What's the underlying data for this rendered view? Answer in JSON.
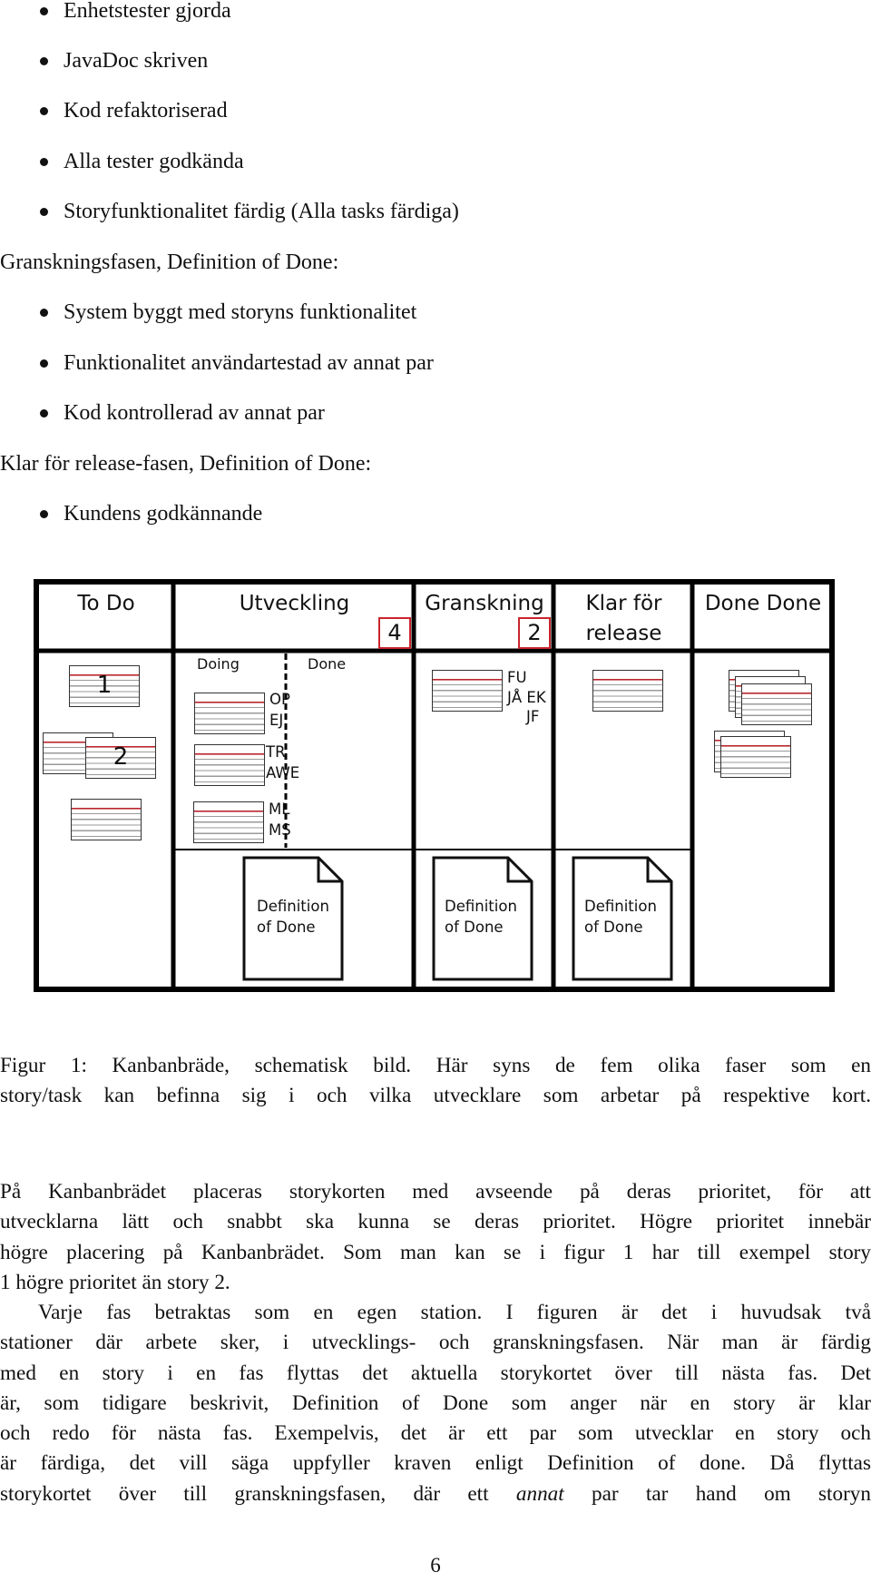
{
  "list_top": {
    "bullets": [
      "Enhetstester gjorda",
      "JavaDoc skriven",
      "Kod refaktoriserad",
      "Alla tester godkända",
      "Storyfunktionalitet färdig (Alla tasks färdiga)"
    ]
  },
  "section_review": {
    "heading": "Granskningsfasen, Definition of Done:",
    "bullets": [
      "System byggt med storyns funktionalitet",
      "Funktionalitet användartestad av annat par",
      "Kod kontrollerad av annat par"
    ]
  },
  "section_release": {
    "heading": "Klar för release-fasen, Definition of Done:",
    "bullets": [
      "Kundens godkännande"
    ]
  },
  "figure": {
    "columns": [
      {
        "title": "To Do"
      },
      {
        "title": "Utveckling",
        "wip_limit": "4",
        "sub_columns": [
          "Doing",
          "Done"
        ]
      },
      {
        "title": "Granskning",
        "wip_limit": "2"
      },
      {
        "title_line1": "Klar för",
        "title_line2": "release"
      },
      {
        "title": "Done Done"
      }
    ],
    "todo_cards": [
      "1",
      "2"
    ],
    "doing_initials": [
      [
        "OP",
        "EJ"
      ],
      [
        "TR",
        "AWE"
      ],
      [
        "ML",
        "MS"
      ]
    ],
    "review_initials": [
      "FU",
      "JÅ EK",
      "JF"
    ],
    "dod_label_line1": "Definition",
    "dod_label_line2": "of Done",
    "colors": {
      "wip_border": "#c8252c",
      "card_header_line": "#b8262c",
      "card_rule": "#9a9a9a"
    }
  },
  "caption": {
    "lines": [
      "Figur 1: Kanbanbräde, schematisk bild. Här syns de fem olika faser som en",
      "story/task kan befinna sig i och vilka utvecklare som arbetar på respektive kort."
    ]
  },
  "paragraph1": {
    "lines": [
      "På Kanbanbrädet placeras storykorten med avseende på deras prioritet, för att",
      "utvecklarna lätt och snabbt ska kunna se deras prioritet. Högre prioritet innebär",
      "högre placering på Kanbanbrädet. Som man kan se i figur 1 har till exempel story",
      "1 högre prioritet än story 2."
    ]
  },
  "paragraph2": {
    "lines": [
      "Varje fas betraktas som en egen station. I figuren är det i huvudsak två",
      "stationer där arbete sker, i utvecklings- och granskningsfasen. När man är färdig",
      "med en story i en fas flyttas det aktuella storykortet över till nästa fas. Det",
      "är, som tidigare beskrivit, Definition of Done som anger när en story är klar",
      "och redo för nästa fas. Exempelvis, det är ett par som utvecklar en story och",
      "är färdiga, det vill säga uppfyller kraven enligt Definition of done. Då flyttas"
    ],
    "last_line_before": "storykortet över till granskningsfasen, där ett ",
    "last_line_emph": "annat",
    "last_line_after": " par tar hand om storyn"
  },
  "page_number": "6"
}
